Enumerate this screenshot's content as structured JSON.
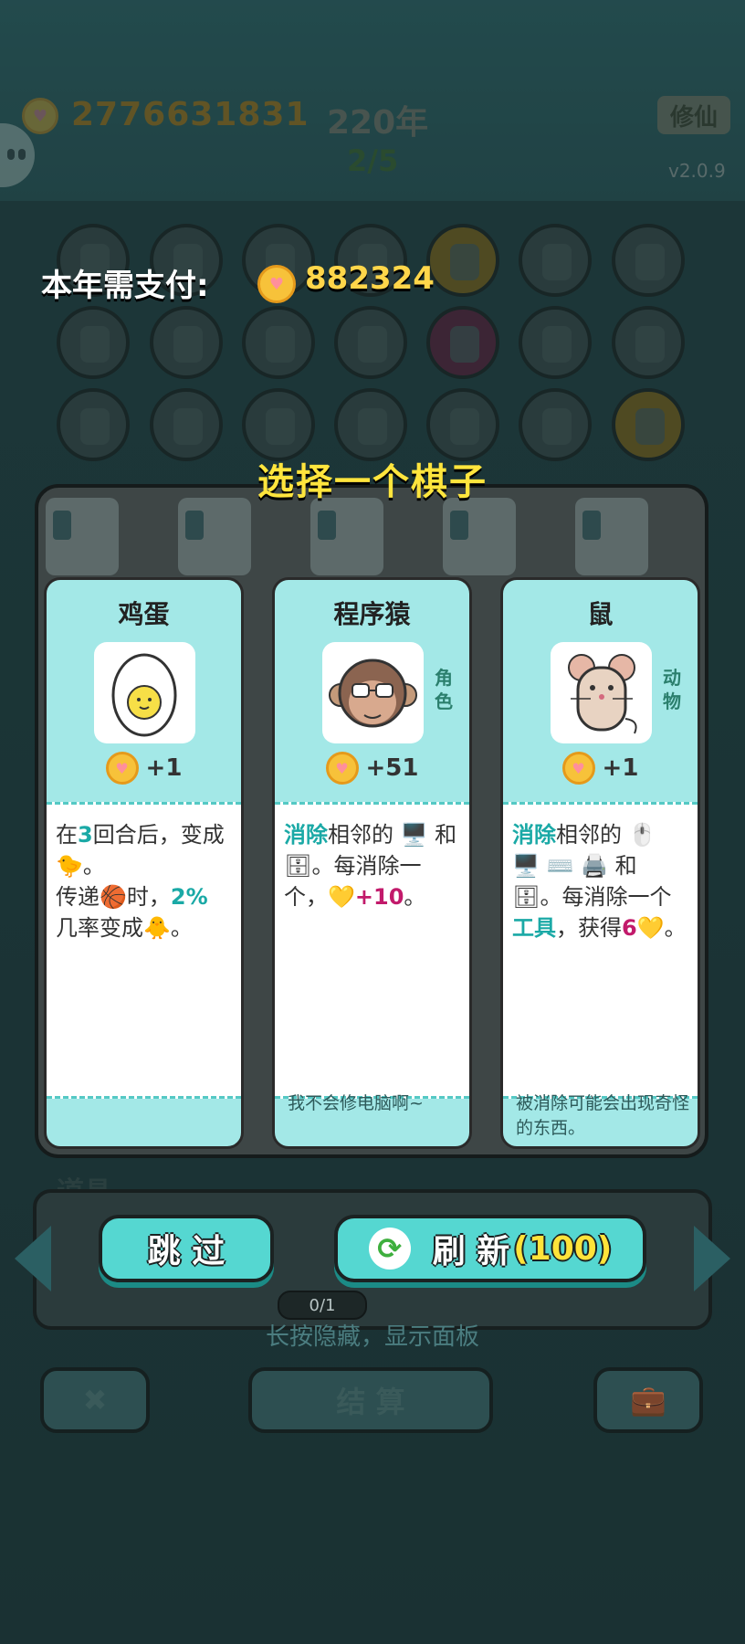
{
  "hud": {
    "money": "2776631831",
    "year": "220年",
    "round": "2/5",
    "cultivate_button": "修仙",
    "version": "v2.0.9"
  },
  "payment": {
    "label": "本年需支付:",
    "amount": "882324"
  },
  "dialog_title": "选择一个棋子",
  "cards": [
    {
      "name": "鸡蛋",
      "type": "",
      "value": "+1",
      "desc": [
        {
          "t": "在"
        },
        {
          "t": "3",
          "k": "pct"
        },
        {
          "t": "回合后，变成"
        },
        {
          "t": "🐤"
        },
        {
          "t": "。"
        },
        {
          "br": true
        },
        {
          "t": "传递"
        },
        {
          "t": "🏀"
        },
        {
          "t": "时，"
        },
        {
          "t": "2%",
          "k": "pct"
        },
        {
          "br": true
        },
        {
          "t": "几率变成"
        },
        {
          "t": "🐥"
        },
        {
          "t": "。"
        }
      ],
      "note": ""
    },
    {
      "name": "程序猿",
      "type": "角色",
      "value": "+51",
      "desc": [
        {
          "t": "消除",
          "k": "kw"
        },
        {
          "t": "相邻的 "
        },
        {
          "t": "🖥️"
        },
        {
          "t": " 和 "
        },
        {
          "t": "🗄"
        },
        {
          "t": "。每消除一个，"
        },
        {
          "t": "💛"
        },
        {
          "t": "+10",
          "k": "coinv"
        },
        {
          "t": "。"
        }
      ],
      "note": "我不会修电脑啊~"
    },
    {
      "name": "鼠",
      "type": "动物",
      "value": "+1",
      "desc": [
        {
          "t": "消除",
          "k": "kw"
        },
        {
          "t": "相邻的 "
        },
        {
          "t": "🖱️"
        },
        {
          "t": " "
        },
        {
          "t": "🖥️"
        },
        {
          "t": " "
        },
        {
          "t": "⌨️"
        },
        {
          "t": " "
        },
        {
          "t": "🖨️"
        },
        {
          "t": " 和 "
        },
        {
          "t": "🗄"
        },
        {
          "t": "。每消除一个"
        },
        {
          "t": "工具",
          "k": "kw"
        },
        {
          "t": "，获得"
        },
        {
          "t": "6",
          "k": "coinv"
        },
        {
          "t": "💛"
        },
        {
          "t": "。"
        }
      ],
      "note": "被消除可能会出现奇怪的东西。"
    }
  ],
  "tools": {
    "label": "道具",
    "skip_button": "跳 过",
    "refresh_button": "刷 新",
    "refresh_price": "(100)",
    "counter": "0/1",
    "hint": "长按隐藏，显示面板"
  },
  "bottom": {
    "settle_button": "结 算"
  },
  "colors": {
    "card_bg": "#a3e8e7",
    "accent": "#55d7d1",
    "keyword": "#1aa9a6",
    "title_yellow": "#ffe53d"
  }
}
